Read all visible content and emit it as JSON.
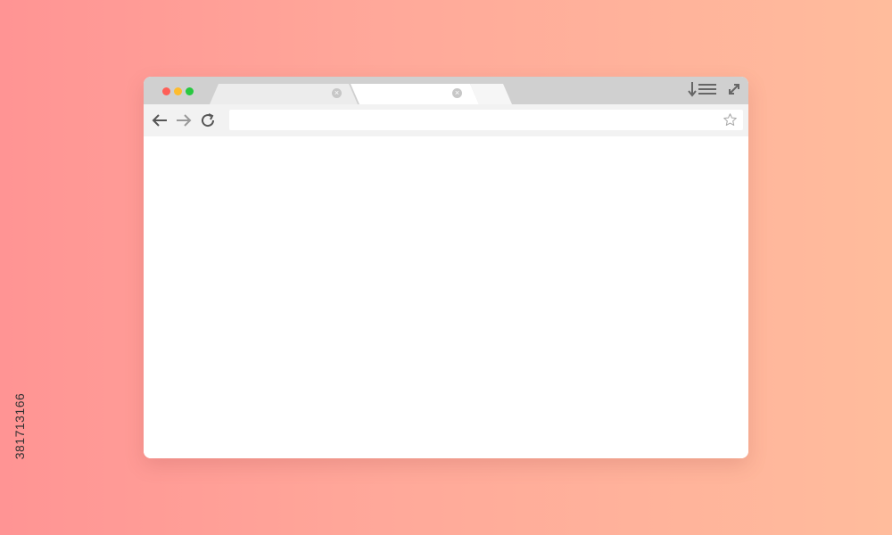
{
  "colors": {
    "background_start": "#ff9494",
    "background_end": "#ffbc9c",
    "titlebar": "#d0d0d0",
    "toolbar": "#f2f2f2",
    "traffic_close": "#fe5f57",
    "traffic_minimize": "#febc2e",
    "traffic_maximize": "#28c840",
    "icon": "#666666"
  },
  "window": {
    "traffic_lights": [
      {
        "name": "close",
        "color": "#fe5f57"
      },
      {
        "name": "minimize",
        "color": "#febc2e"
      },
      {
        "name": "maximize",
        "color": "#28c840"
      }
    ],
    "tabs": [
      {
        "label": "",
        "active": false,
        "close_icon": "close-icon"
      },
      {
        "label": "",
        "active": true,
        "close_icon": "close-icon"
      },
      {
        "label": "",
        "active": false
      }
    ],
    "controls": [
      "download-icon",
      "menu-icon",
      "expand-icon"
    ]
  },
  "toolbar": {
    "back_icon": "arrow-left-icon",
    "forward_icon": "arrow-right-icon",
    "reload_icon": "reload-icon",
    "address": {
      "value": "",
      "placeholder": ""
    },
    "bookmark_icon": "star-icon"
  },
  "watermark": {
    "stock_id": "381713166"
  }
}
